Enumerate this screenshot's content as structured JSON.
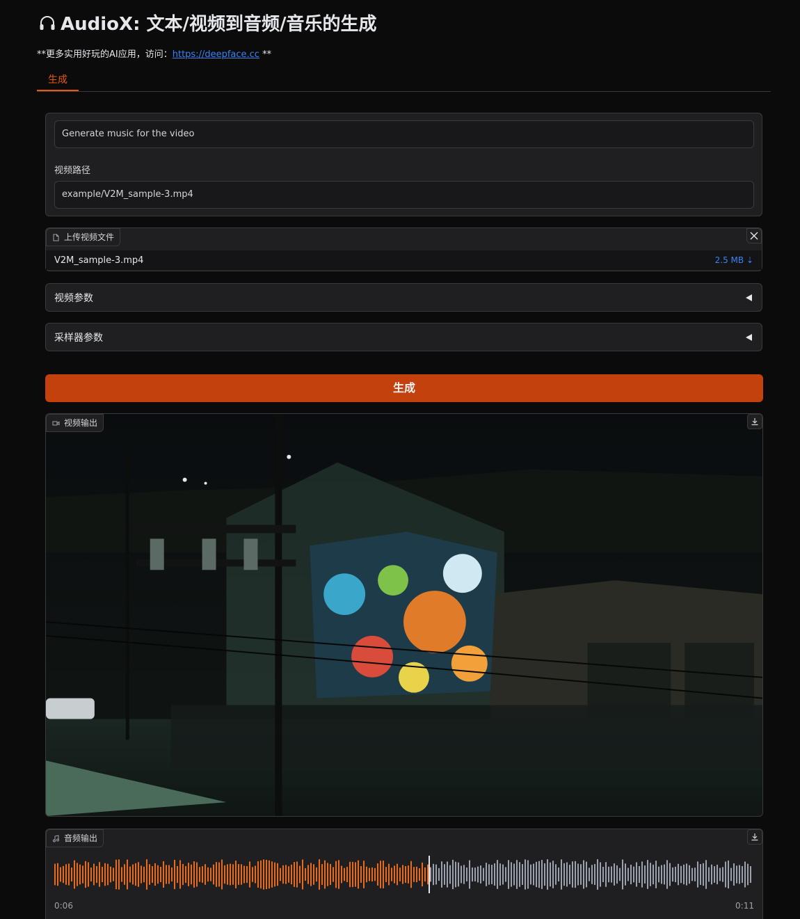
{
  "header": {
    "title": "AudioX: 文本/视频到音频/音乐的生成",
    "subtitle_prefix": "**更多实用好玩的AI应用，访问：",
    "subtitle_link": "https://deepface.cc",
    "subtitle_suffix": " **"
  },
  "tabs": [
    {
      "label": "生成",
      "active": true
    }
  ],
  "form": {
    "prompt_value": "Generate music for the video",
    "video_path_label": "视频路径",
    "video_path_value": "example/V2M_sample-3.mp4"
  },
  "upload": {
    "label": "上传视频文件",
    "file_name": "V2M_sample-3.mp4",
    "file_size": "2.5 MB ⇣"
  },
  "accordions": [
    {
      "label": "视频参数"
    },
    {
      "label": "采样器参数"
    }
  ],
  "generate_button": "生成",
  "video_output": {
    "label": "视频输出"
  },
  "audio_output": {
    "label": "音频输出",
    "current_time": "0:06",
    "duration": "0:11",
    "progress": 0.535,
    "played_color": "#ea6a1e",
    "unplayed_color": "#9ca3af"
  }
}
